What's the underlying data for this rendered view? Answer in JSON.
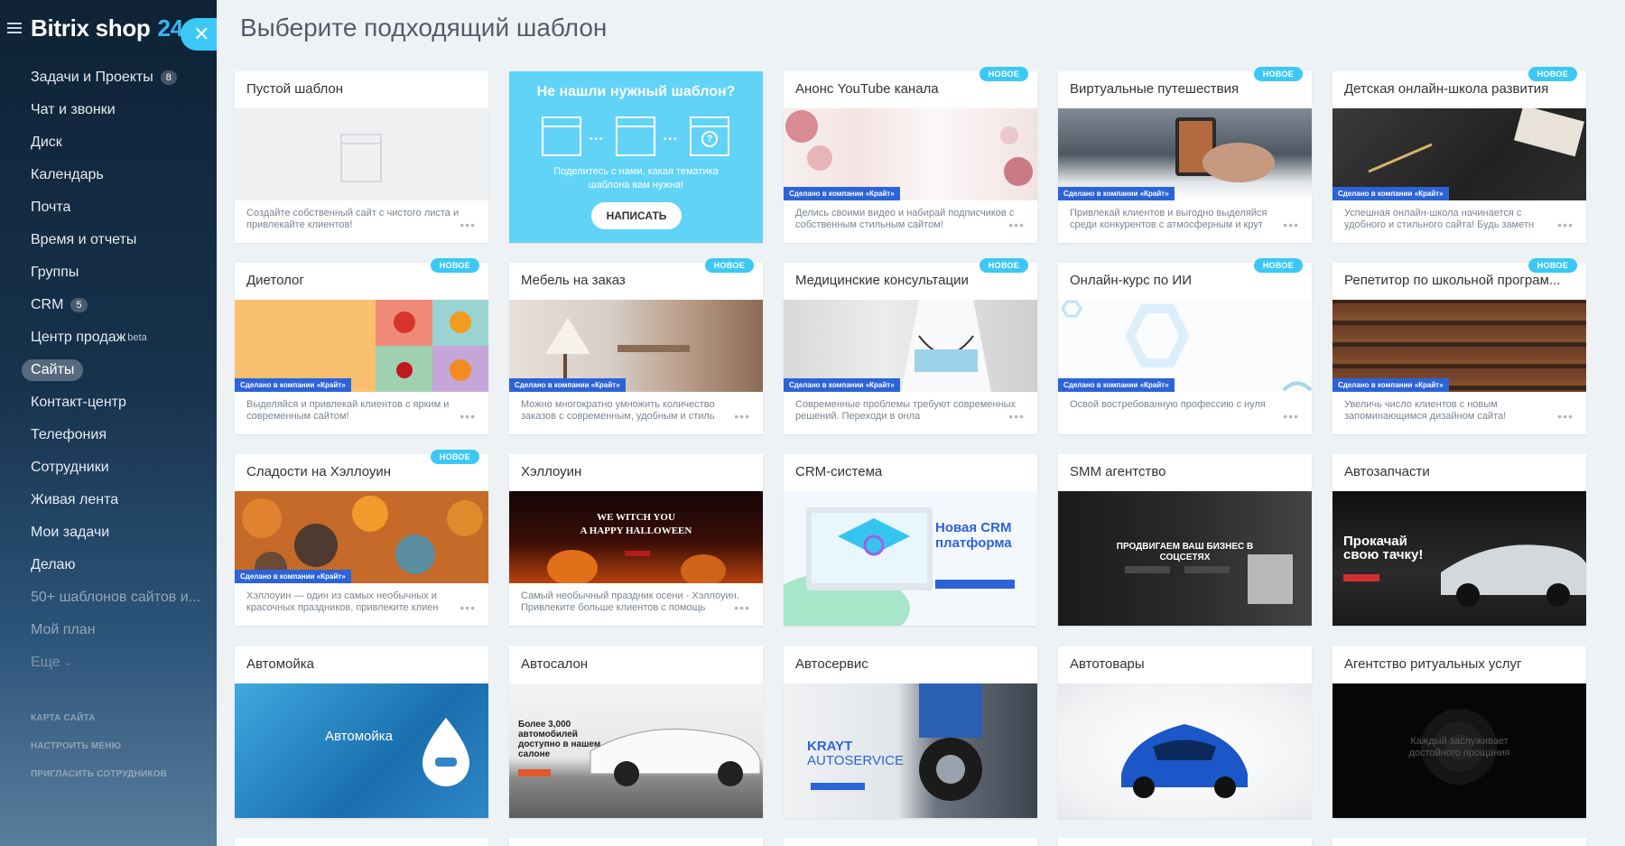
{
  "sidebar": {
    "logo_name": "Bitrix shop",
    "logo_num": "24",
    "items": [
      {
        "label": "Задачи и Проекты",
        "badge": "8"
      },
      {
        "label": "Чат и звонки"
      },
      {
        "label": "Диск"
      },
      {
        "label": "Календарь"
      },
      {
        "label": "Почта"
      },
      {
        "label": "Время и отчеты"
      },
      {
        "label": "Группы"
      },
      {
        "label": "CRM",
        "badge": "5"
      },
      {
        "label": "Центр продаж",
        "sup": "beta"
      },
      {
        "label": "Сайты"
      },
      {
        "label": "Контакт-центр"
      },
      {
        "label": "Телефония"
      },
      {
        "label": "Сотрудники"
      },
      {
        "label": "Живая лента"
      },
      {
        "label": "Мои задачи"
      },
      {
        "label": "Делаю"
      },
      {
        "label": "50+ шаблонов сайтов и..."
      },
      {
        "label": "Мой план"
      },
      {
        "label": "Еще"
      }
    ],
    "links": [
      "КАРТА САЙТА",
      "НАСТРОИТЬ МЕНЮ",
      "ПРИГЛАСИТЬ СОТРУДНИКОВ"
    ]
  },
  "page_title": "Выберите подходящий шаблон",
  "new_label": "НОВОЕ",
  "krayt_label": "Сделано в компании «Крайт»",
  "promo": {
    "title": "Не нашли нужный шаблон?",
    "text": "Поделитесь с нами, какая тематика шаблона вам нужна!",
    "button": "НАПИСАТЬ"
  },
  "cards": [
    {
      "title": "Пустой шаблон",
      "desc": "Создайте собственный сайт с чистого листа и привлекайте клиентов!"
    },
    {
      "title": "Анонс YouTube канала",
      "desc": "Делись своими видео и набирай подписчиков с собственным стильным сайтом!"
    },
    {
      "title": "Виртуальные путешествия",
      "desc": "Привлекай клиентов и выгодно выделяйся среди конкурентов с атмосферным и крут"
    },
    {
      "title": "Детская онлайн-школа развития",
      "desc": "Успешная онлайн-школа начинается с удобного и стильного сайта! Будь заметн"
    },
    {
      "title": "Диетолог",
      "desc": "Выделяйся и привлекай клиентов с ярким и современным сайтом!"
    },
    {
      "title": "Мебель на заказ",
      "desc": "Можно многократно умножить количество заказов с современным, удобным и стиль"
    },
    {
      "title": "Медицинские консультации",
      "desc": "Современные проблемы требуют современных решений. Переходи в онла"
    },
    {
      "title": "Онлайн-курс по ИИ",
      "desc": "Освой востребованную профессию с нуля"
    },
    {
      "title": "Репетитор по школьной програм...",
      "desc": "Увеличь число клиентов с новым запоминающимся дизайном сайта!"
    },
    {
      "title": "Сладости на Хэллоуин",
      "desc": "Хэллоуин — один из самых необычных и красочных праздников, привлеките клиен"
    },
    {
      "title": "Хэллоуин",
      "desc": "Самый необычный праздник осени - Хэллоуин. Привлеките больше клиентов с помощь"
    },
    {
      "title": "CRM-система"
    },
    {
      "title": "SMM агентство"
    },
    {
      "title": "Автозапчасти"
    },
    {
      "title": "Автомойка"
    },
    {
      "title": "Автосалон"
    },
    {
      "title": "Автосервис"
    },
    {
      "title": "Автотовары"
    },
    {
      "title": "Агентство ритуальных услуг"
    }
  ],
  "thumb_text": {
    "halloween": [
      "WE WITCH YOU",
      "A HAPPY HALLOWEEN"
    ],
    "crm": [
      "Новая CRM",
      "платформа"
    ],
    "smm": [
      "ПРОДВИГАЕМ ВАШ БИЗНЕС В",
      "СОЦСЕТЯХ"
    ],
    "autoparts": [
      "Прокачай",
      "свою тачку!"
    ],
    "carwash": "Автомойка",
    "carsalon": [
      "Более 3,000",
      "автомобилей",
      "доступно в нашем",
      "салоне"
    ],
    "autoservice": [
      "KRAYT",
      "AUTOSERVICE"
    ],
    "ritual": [
      "Каждый заслуживает",
      "достойного прощания"
    ]
  }
}
